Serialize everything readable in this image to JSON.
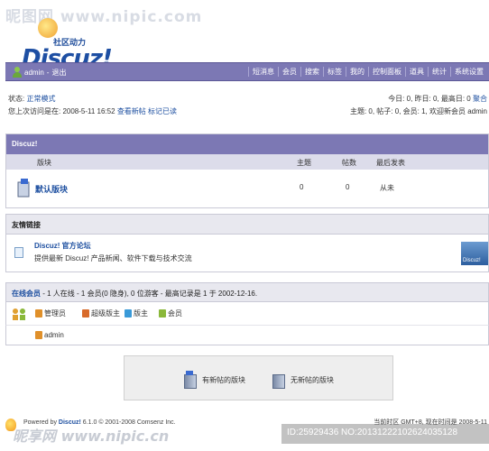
{
  "watermark": {
    "top": "昵图网 www.nipic.com",
    "bottom": "昵享网 www.nipic.cn",
    "id": "ID:25929436 NO:20131222102624035128"
  },
  "logo": {
    "subtitle": "社区动力",
    "name": "Discuz!"
  },
  "menubar": {
    "username": "admin",
    "logout": "退出",
    "items": [
      "短消息",
      "会员",
      "搜索",
      "标签",
      "我的",
      "控制面板",
      "道具",
      "统计",
      "系统设置"
    ]
  },
  "status": {
    "mode_label": "状态:",
    "mode_value": "正常模式",
    "last_visit": "您上次访问是在: 2008-5-11 16:52",
    "view_new": "查看新帖",
    "mark_read": "标记已读",
    "today": "今日: 0, 昨日: 0, 最高日: 0",
    "feed": "聚合",
    "stats": "主题: 0, 帖子: 0, 会员: 1, 欢迎新会员 admin"
  },
  "forum": {
    "title": "Discuz!",
    "headers": {
      "board": "版块",
      "topics": "主题",
      "posts": "帖数",
      "last_post": "最后发表"
    },
    "rows": [
      {
        "name": "默认版块",
        "topics": "0",
        "posts": "0",
        "last_post": "从未"
      }
    ]
  },
  "links": {
    "title": "友情链接",
    "items": [
      {
        "name": "Discuz! 官方论坛",
        "desc": "提供最新 Discuz! 产品新闻、软件下载与技术交流",
        "banner": "Discuz!"
      }
    ]
  },
  "online": {
    "title": "在线会员",
    "summary": "- 1 人在线 - 1 会员(0 隐身), 0 位游客 - 最高记录是 1 于 2002-12-16.",
    "legend": [
      {
        "label": "管理员",
        "color": "#e0902a"
      },
      {
        "label": "超级版主",
        "color": "#d86a2a"
      },
      {
        "label": "版主",
        "color": "#3a9ad8"
      },
      {
        "label": "会员",
        "color": "#8ab83a"
      }
    ],
    "users": [
      "admin"
    ]
  },
  "key": {
    "new_posts": "有新帖的版块",
    "no_new_posts": "无新帖的版块"
  },
  "footer": {
    "powered_prefix": "Powered by",
    "powered_name": "Discuz!",
    "version": "6.1.0",
    "copyright": "© 2001-2008 Comsenz Inc.",
    "timezone": "当前时区 GMT+8, 现在时间是 2008-5-11"
  }
}
